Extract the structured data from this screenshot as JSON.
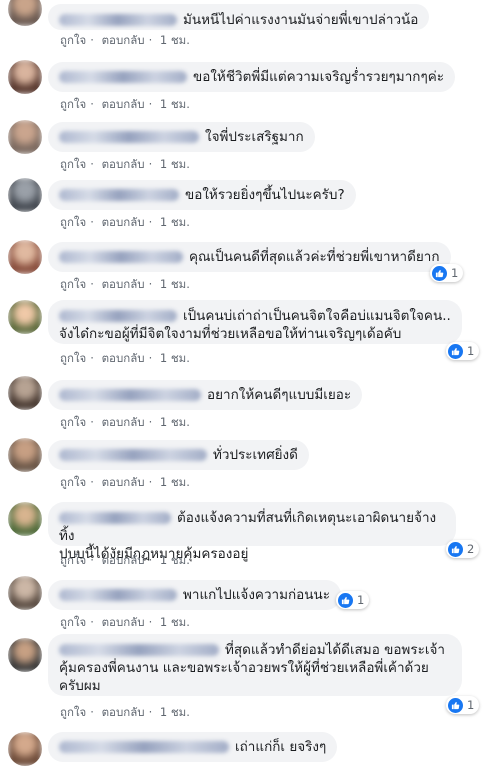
{
  "labels": {
    "like": "ถูกใจ",
    "reply": "ตอบกลับ",
    "dot": "·",
    "time": "1 ชม."
  },
  "comments": [
    {
      "text": "มันหนีไปค่าแรงงานมันจ่ายพี่เขาปล่าวน้อ",
      "reactions": null
    },
    {
      "text": "ขอให้ชีวิตพี่มีแต่ความเจริญร่ำรวยๆมากๆค่ะ",
      "reactions": null
    },
    {
      "text": "ใจพี่ประเสริฐมาก",
      "reactions": null
    },
    {
      "text": "ขอให้รวยยิ่งๆขึ้นไปนะครับ?",
      "reactions": null
    },
    {
      "text": "คุณเป็นคนดีที่สุดแล้วค่ะที่ช่วยพี่เขาหาดียาก",
      "reactions": "1"
    },
    {
      "text": "เป็นคนบ่เถ่าถ่าเป็นคนจิตใจคือบ่แมนจิตใจคน..\nจังได๋กะขอผู้ที่มีจิตใจงามที่ช่วยเหลือขอให้ท่านเจริญๆเด้อคับ",
      "reactions": "1"
    },
    {
      "text": "อยากให้คนดีๆแบบมีเยอะ",
      "reactions": null
    },
    {
      "text": "ทั่วประเทศยิ่งดี",
      "reactions": null
    },
    {
      "text": "ต้องแจ้งความที่สนที่เกิดเหตุนะเอาผิดนายจ้างทิ้ง\nปบบนี้ได้งัยมีกฎหมายคุ้มครองอยู่",
      "reactions": "2"
    },
    {
      "text": "พาแกไปแจ้งความก่อนนะ",
      "reactions": "1"
    },
    {
      "text": "ที่สุดแล้วทำดีย่อมได้ดีเสมอ ขอพระเจ้า\nคุ้มครองพี่คนงาน และขอพระเจ้าอวยพรให้ผู้ที่ช่วยเหลือพี่เค้าด้วย\nครับผม",
      "reactions": "1"
    },
    {
      "text": "เถ่าแก่ก็เ ยจริงๆ",
      "reactions": null
    }
  ],
  "colors": {
    "like_blue": "#1877f2",
    "bubble": "#f2f3f5"
  }
}
